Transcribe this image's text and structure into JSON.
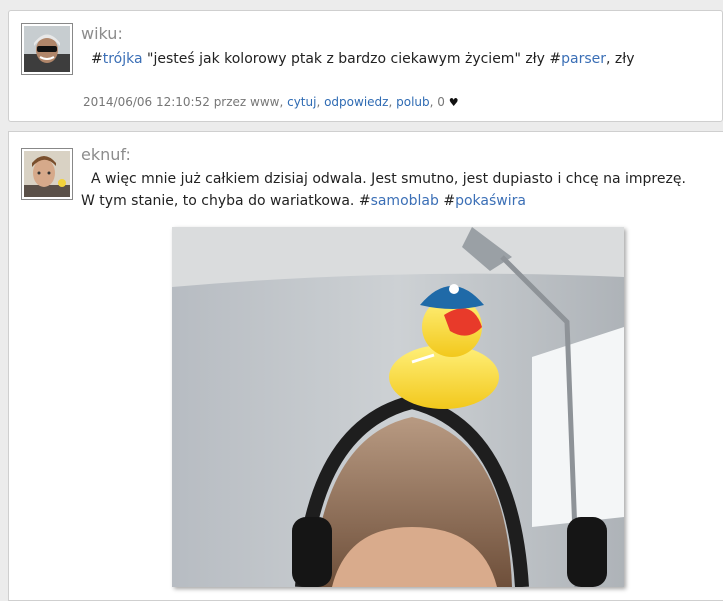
{
  "posts": [
    {
      "author": "wiku:",
      "segments": [
        {
          "type": "tag",
          "hash": "#",
          "word": "trójka"
        },
        {
          "type": "text",
          "value": " \"jesteś jak kolorowy ptak z bardzo ciekawym życiem\" zły "
        },
        {
          "type": "tag",
          "hash": "#",
          "word": "parser"
        },
        {
          "type": "text",
          "value": ", zły"
        }
      ],
      "meta": {
        "timestamp": "2014/06/06 12:10:52",
        "via": " przez www, ",
        "quote": "cytuj",
        "reply": "odpowiedz",
        "like": "polub",
        "likes_count": "0",
        "heart": "♥"
      }
    },
    {
      "author": "eknuf:",
      "segments": [
        {
          "type": "text",
          "value": "A więc mnie już całkiem dzisiaj odwala. Jest smutno, jest dupiasto i chcę na imprezę. W tym stanie, to chyba do wariatkowa. "
        },
        {
          "type": "tag",
          "hash": "#",
          "word": "samoblab"
        },
        {
          "type": "text",
          "value": " "
        },
        {
          "type": "tag",
          "hash": "#",
          "word": "pokaświra"
        }
      ]
    }
  ]
}
